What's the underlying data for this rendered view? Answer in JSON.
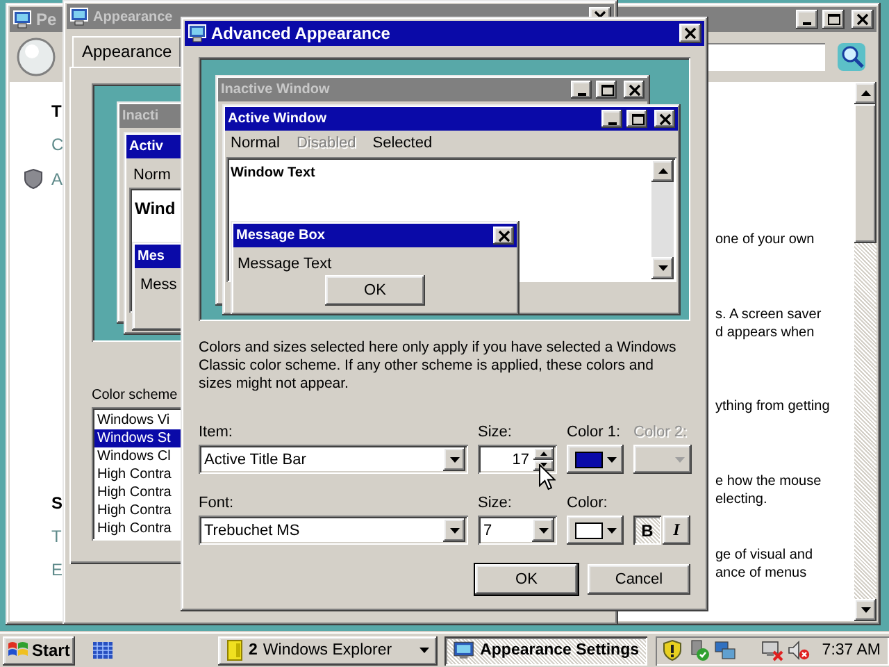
{
  "personalization_window": {
    "title": "Pe",
    "active": false,
    "sidebar": {
      "top": [
        {
          "text": "T",
          "kind": "heading"
        },
        {
          "text": "C",
          "kind": "link"
        },
        {
          "text": "A",
          "kind": "shield_link"
        }
      ],
      "bottom": [
        {
          "text": "S",
          "kind": "heading"
        },
        {
          "text": "T",
          "kind": "link"
        },
        {
          "text": "E",
          "kind": "link"
        }
      ]
    },
    "paragraphs": [
      {
        "lines": [
          "one of your own"
        ]
      },
      {
        "lines": [
          "s. A screen saver",
          "d appears when"
        ]
      },
      {
        "lines": [
          "ything from getting"
        ]
      },
      {
        "lines": [
          "e how the mouse",
          "electing."
        ]
      },
      {
        "lines": [
          "ge of visual and",
          "ance of menus"
        ]
      }
    ]
  },
  "appearance_settings": {
    "title": "Appearance",
    "active": false,
    "tabs": [
      {
        "label": "Appearance",
        "selected": true
      }
    ],
    "preview": {
      "inactive_title": "Inacti",
      "active_title": "Activ",
      "menu_item": "Norm",
      "window_text": "Wind",
      "message_title": "Mes",
      "message_text": "Mess"
    },
    "color_scheme_label": "Color scheme",
    "color_schemes": [
      {
        "label": "Windows Vi",
        "selected": false
      },
      {
        "label": "Windows St",
        "selected": true
      },
      {
        "label": "Windows Cl",
        "selected": false
      },
      {
        "label": "High Contra",
        "selected": false
      },
      {
        "label": "High Contra",
        "selected": false
      },
      {
        "label": "High Contra",
        "selected": false
      },
      {
        "label": "High Contra",
        "selected": false
      }
    ]
  },
  "advanced_appearance": {
    "title": "Advanced Appearance",
    "active": true,
    "preview": {
      "inactive_title": "Inactive Window",
      "active_title": "Active Window",
      "menu": [
        {
          "label": "Normal",
          "disabled": false
        },
        {
          "label": "Disabled",
          "disabled": true
        },
        {
          "label": "Selected",
          "disabled": false
        }
      ],
      "window_text": "Window Text",
      "message_title": "Message Box",
      "message_text": "Message Text",
      "ok_label": "OK"
    },
    "description": "Colors and sizes selected here only apply if you have selected a Windows Classic color scheme. If any other scheme is applied, these colors and sizes might not appear.",
    "item": {
      "label": "Item:",
      "value": "Active Title Bar"
    },
    "item_size": {
      "label": "Size:",
      "value": "17"
    },
    "color1": {
      "label": "Color 1:",
      "disabled": false,
      "color": "#0a0aa8"
    },
    "color2": {
      "label": "Color 2:",
      "disabled": true
    },
    "font": {
      "label": "Font:",
      "value": "Trebuchet MS"
    },
    "font_size": {
      "label": "Size:",
      "value": "7"
    },
    "font_color": {
      "label": "Color:",
      "disabled": false,
      "color": "#ffffff"
    },
    "bold": {
      "label": "B",
      "on": true
    },
    "italic": {
      "label": "I",
      "on": false
    },
    "buttons": [
      {
        "label": "OK",
        "default": true
      },
      {
        "label": "Cancel",
        "default": false
      }
    ]
  },
  "taskbar": {
    "start_label": "Start",
    "tasks": [
      {
        "count": "2",
        "label": "Windows Explorer",
        "kind": "group",
        "selected": false
      },
      {
        "label": "Appearance Settings",
        "kind": "window",
        "selected": true
      }
    ],
    "clock": "7:37 AM"
  }
}
